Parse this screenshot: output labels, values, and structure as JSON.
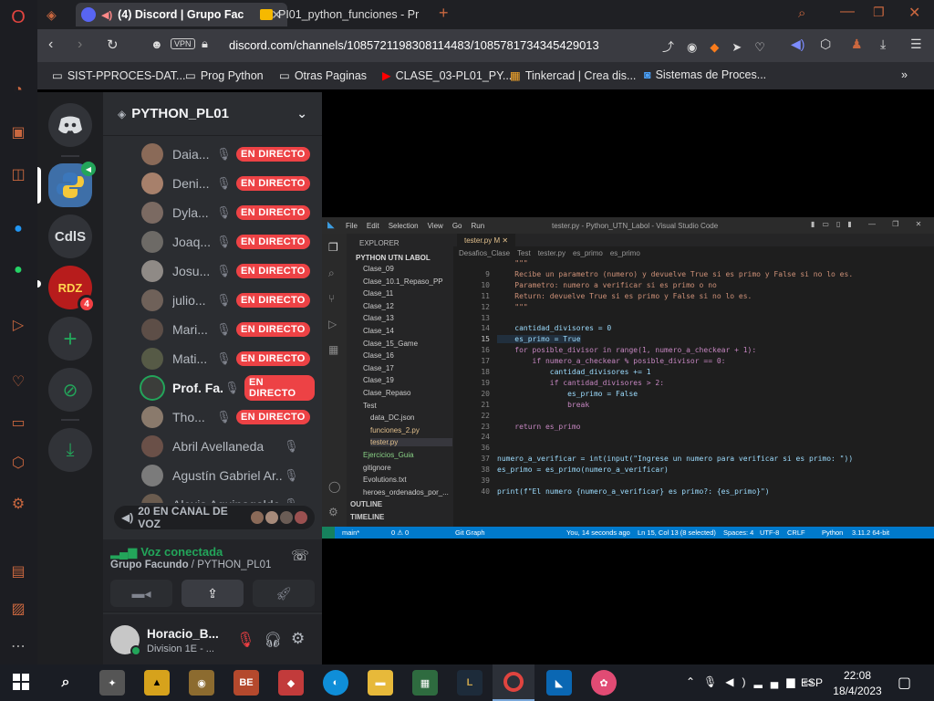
{
  "browser": {
    "tabs": [
      {
        "label": "(4) Discord | Grupo Fac"
      },
      {
        "label": "PI01_python_funciones - Pr"
      }
    ],
    "url": "discord.com/channels/1085721198308114483/1085781734345429013",
    "vpn": "VPN",
    "bookmarks": [
      "SIST-PPROCES-DAT...",
      "Prog Python",
      "Otras Paginas",
      "CLASE_03-PL01_PY...",
      "Tinkercad | Crea dis...",
      "Sistemas de Proces..."
    ]
  },
  "discord": {
    "server_name": "PYTHON_PL01",
    "guilds": [
      {
        "label": "CdlS"
      },
      {
        "label": "RDZ",
        "badge": "4"
      }
    ],
    "live_label": "EN DIRECTO",
    "users": [
      {
        "name": "Daia...",
        "live": true,
        "color": "#8a6a58"
      },
      {
        "name": "Deni...",
        "live": true,
        "color": "#a7806b"
      },
      {
        "name": "Dyla...",
        "live": true,
        "color": "#7b6a62"
      },
      {
        "name": "Joaq...",
        "live": true,
        "color": "#6d6a66"
      },
      {
        "name": "Josu...",
        "live": true,
        "color": "#8f8a86"
      },
      {
        "name": "julio...",
        "live": true,
        "color": "#6f6159"
      },
      {
        "name": "Mari...",
        "live": true,
        "color": "#5d4e47"
      },
      {
        "name": "Mati...",
        "live": true,
        "color": "#565a46"
      },
      {
        "name": "Prof. Fa...",
        "live": true,
        "color": "#3b3d3a",
        "bold": true
      },
      {
        "name": "Tho...",
        "live": true,
        "color": "#8a7a6c"
      },
      {
        "name": "Abril Avellaneda",
        "live": false,
        "color": "#6a5048"
      },
      {
        "name": "Agustín Gabriel Ar...",
        "live": false,
        "color": "#7b7b7b"
      },
      {
        "name": "Alexis Aguinagalde",
        "live": false,
        "color": "#6b5c4f"
      }
    ],
    "voice_channel_pill": "20 EN CANAL DE VOZ",
    "voice_status": "Voz conectada",
    "voice_location_group": "Grupo Facundo",
    "voice_location_channel": "PYTHON_PL01",
    "username": "Horacio_B...",
    "user_status": "Division 1E - ..."
  },
  "vscode": {
    "menu": [
      "File",
      "Edit",
      "Selection",
      "View",
      "Go",
      "Run"
    ],
    "title": "tester.py - Python_UTN_Labol - Visual Studio Code",
    "tab": "tester.py",
    "explorer_header": "EXPLORER",
    "project": "PYTHON UTN LABOL",
    "breadcrumb": [
      "Desafios_Clase",
      "Test",
      "tester.py",
      "es_primo",
      "es_primo"
    ],
    "files": [
      "Clase_09",
      "Clase_10.1_Repaso_PP",
      "Clase_11",
      "Clase_12",
      "Clase_13",
      "Clase_14",
      "Clase_15_Game",
      "Clase_16",
      "Clase_17",
      "Clase_19",
      "Clase_Repaso",
      "Test",
      "data_DC.json",
      "funciones_2.py",
      "tester.py",
      "Ejercicios_Guia",
      "gitignore",
      "Evolutions.txt",
      "heroes_ordenados_por_...",
      "OUTLINE",
      "TIMELINE"
    ],
    "code": [
      {
        "n": "",
        "t": "    \"\"\""
      },
      {
        "n": "9",
        "t": "    Recibe un parametro (numero) y devuelve True si es primo y False si no lo es."
      },
      {
        "n": "10",
        "t": "    Parametro: numero a verificar si es primo o no"
      },
      {
        "n": "11",
        "t": "    Return: devuelve True si es primo y False si no lo es."
      },
      {
        "n": "12",
        "t": "    \"\"\""
      },
      {
        "n": "13",
        "t": ""
      },
      {
        "n": "14",
        "t": "    cantidad_divisores = 0"
      },
      {
        "n": "15",
        "t": "    es_primo = True"
      },
      {
        "n": "16",
        "t": "    for posible_divisor in range(1, numero_a_checkear + 1):"
      },
      {
        "n": "17",
        "t": "        if numero_a_checkear % posible_divisor == 0:"
      },
      {
        "n": "18",
        "t": "            cantidad_divisores += 1"
      },
      {
        "n": "19",
        "t": "            if cantidad_divisores > 2:"
      },
      {
        "n": "20",
        "t": "                es_primo = False"
      },
      {
        "n": "21",
        "t": "                break"
      },
      {
        "n": "22",
        "t": ""
      },
      {
        "n": "23",
        "t": "    return es_primo"
      },
      {
        "n": "24",
        "t": ""
      },
      {
        "n": "36",
        "t": ""
      },
      {
        "n": "37",
        "t": "numero_a_verificar = int(input(\"Ingrese un numero para verificar si es primo: \"))"
      },
      {
        "n": "38",
        "t": "es_primo = es_primo(numero_a_verificar)"
      },
      {
        "n": "39",
        "t": ""
      },
      {
        "n": "40",
        "t": "print(f\"El numero {numero_a_verificar} es primo?: {es_primo}\")"
      }
    ],
    "status": {
      "branch": "main*",
      "errors": "0 ⚠ 0",
      "git": "Git Graph",
      "blame": "You, 14 seconds ago",
      "pos": "Ln 15, Col 13 (8 selected)",
      "spaces": "Spaces: 4",
      "enc": "UTF-8",
      "eol": "CRLF",
      "lang": "Python",
      "ver": "3.11.2 64-bit"
    }
  },
  "taskbar": {
    "time": "22:08",
    "date": "18/4/2023",
    "lang": "ESP"
  }
}
